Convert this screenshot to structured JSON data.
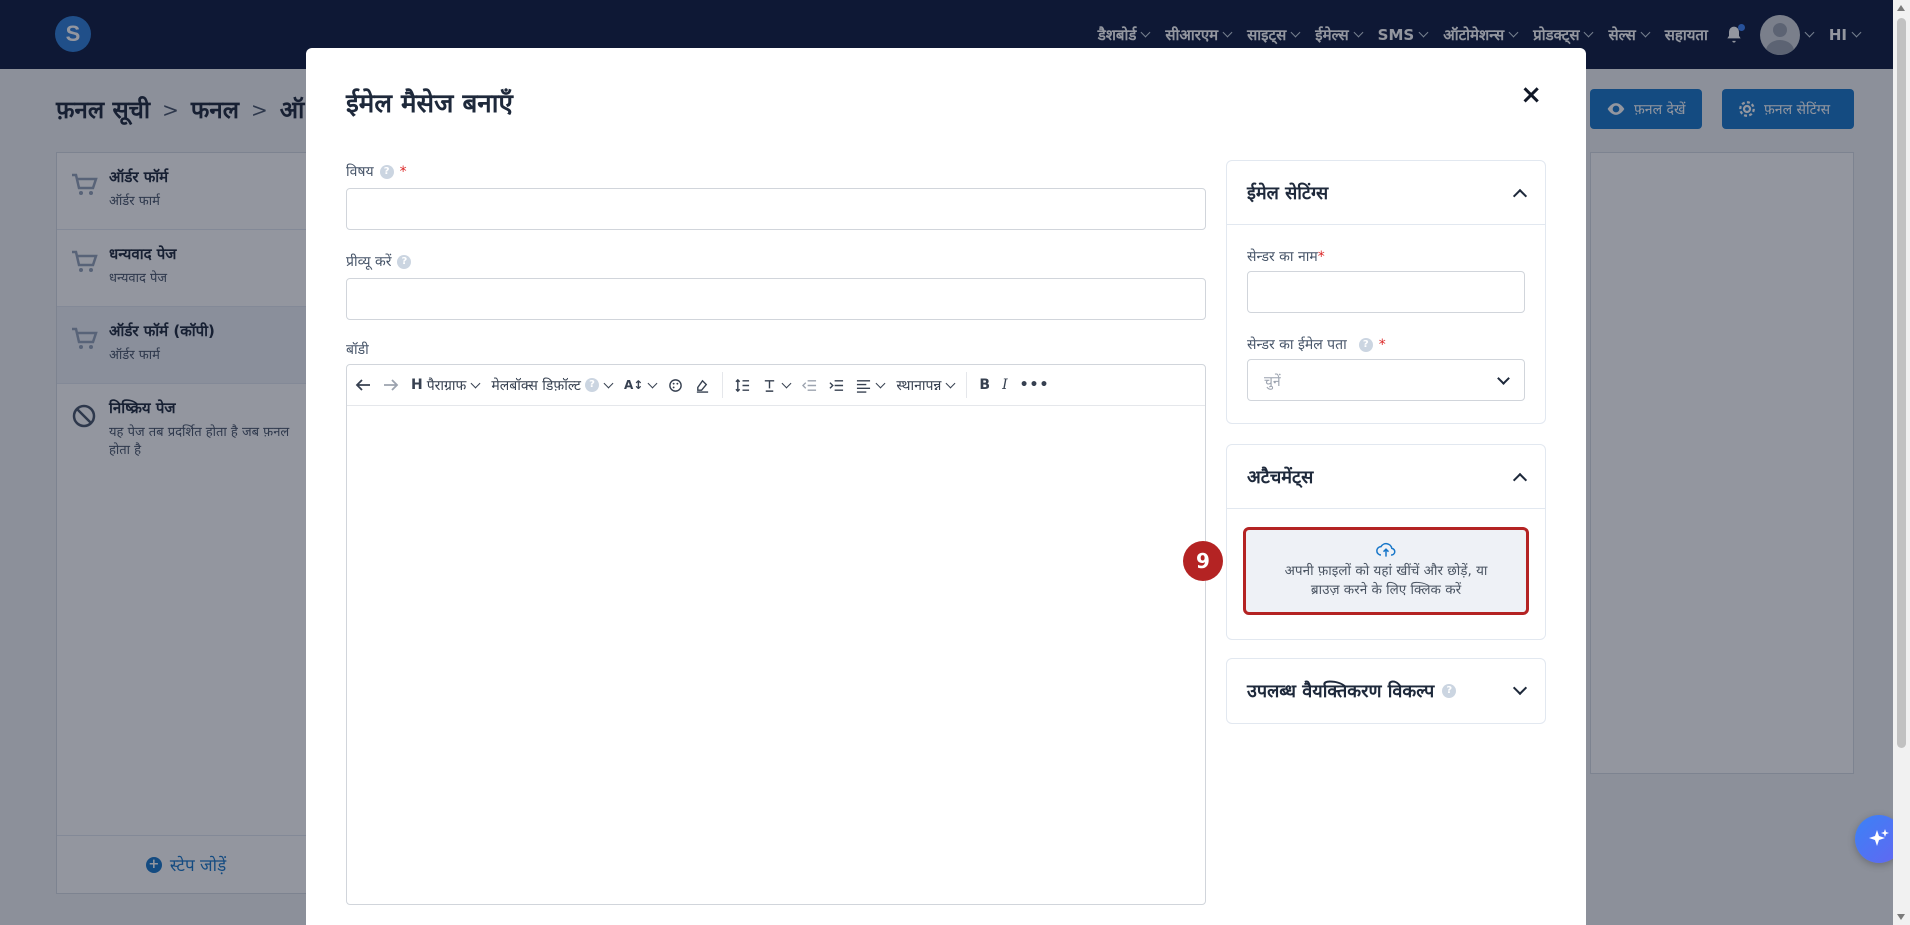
{
  "topbar": {
    "logo_letter": "S",
    "nav": [
      {
        "label": "डैशबोर्ड"
      },
      {
        "label": "सीआरएम"
      },
      {
        "label": "साइट्स"
      },
      {
        "label": "ईमेल्स"
      },
      {
        "label": "SMS"
      },
      {
        "label": "ऑटोमेशन्स"
      },
      {
        "label": "प्रोडक्ट्स"
      },
      {
        "label": "सेल्स"
      },
      {
        "label": "सहायता"
      }
    ],
    "language": "HI"
  },
  "background": {
    "breadcrumb": [
      "फ़नल सूची",
      "फनल",
      "ऑ"
    ],
    "view_funnel_button": "फ़नल देखें",
    "funnel_settings_button": "फ़नल सेटिंग्स",
    "steps": [
      {
        "title": "ऑर्डर फॉर्म",
        "subtitle": "ऑर्डर फार्म"
      },
      {
        "title": "धन्यवाद पेज",
        "subtitle": "धन्यवाद पेज"
      },
      {
        "title": "ऑर्डर फॉर्म (कॉपी)",
        "subtitle": "ऑर्डर फार्म"
      },
      {
        "title": "निष्क्रिय पेज",
        "subtitle": "यह पेज तब प्रदर्शित होता है जब फ़नल",
        "subtitle2": "होता है"
      }
    ],
    "add_step": "स्टेप जोड़ें"
  },
  "modal": {
    "title": "ईमेल मैसेज बनाएँ",
    "close": "×",
    "subject_label": "विषय",
    "preview_label": "प्रीव्यू करें",
    "body_label": "बॉडी",
    "toolbar": {
      "paragraph": "पैराग्राफ",
      "mailbox_default": "मेलबॉक्स डिफ़ॉल्ट",
      "placeholder": "स्थानापन्न",
      "bold": "B",
      "italic": "I"
    },
    "email_settings": {
      "title": "ईमेल सेटिंग्स",
      "sender_name_label": "सेन्डर का नाम",
      "sender_email_label": "सेन्डर का ईमेल पता",
      "select_placeholder": "चुनें"
    },
    "attachments": {
      "title": "अटैचमेंट्स",
      "dropzone_line1": "अपनी फ़ाइलों को यहां खींचें और छोड़ें, या",
      "dropzone_line2": "ब्राउज़ करने के लिए क्लिक करें"
    },
    "personalization": {
      "title": "उपलब्ध वैयक्तिकरण विकल्प"
    },
    "step_marker": "9"
  }
}
